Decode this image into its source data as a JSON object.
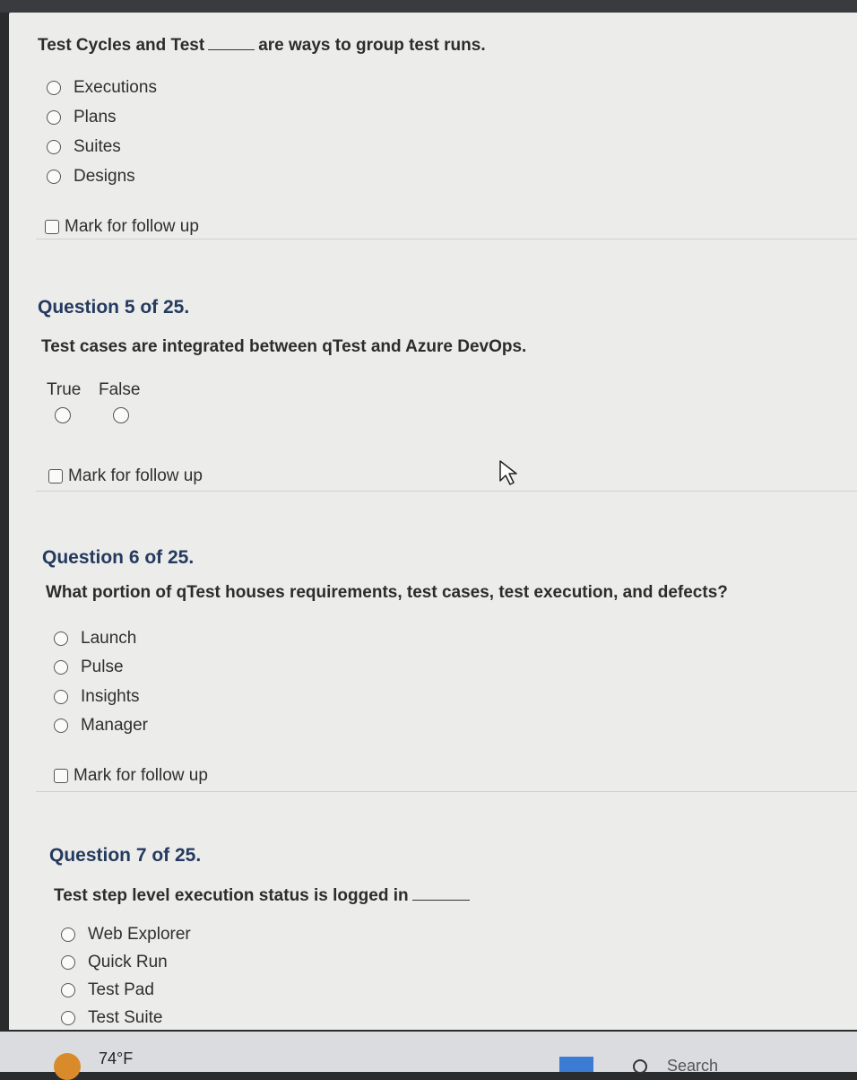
{
  "q4": {
    "text_before": "Test Cycles and Test",
    "text_after": "are ways to group test runs.",
    "options": [
      "Executions",
      "Plans",
      "Suites",
      "Designs"
    ],
    "follow_up": "Mark for follow up"
  },
  "q5": {
    "title": "Question 5 of 25.",
    "text": "Test cases are integrated between qTest and Azure DevOps.",
    "true_label": "True",
    "false_label": "False",
    "follow_up": "Mark for follow up"
  },
  "q6": {
    "title": "Question 6 of 25.",
    "text": "What portion of qTest houses requirements, test cases, test execution, and defects?",
    "options": [
      "Launch",
      "Pulse",
      "Insights",
      "Manager"
    ],
    "follow_up": "Mark for follow up"
  },
  "q7": {
    "title": "Question 7 of 25.",
    "text": "Test step level execution status is logged in",
    "options": [
      "Web Explorer",
      "Quick Run",
      "Test Pad",
      "Test Suite"
    ]
  },
  "taskbar": {
    "temperature": "74°F",
    "search_label": "Search"
  },
  "icons": [
    "weather-icon",
    "search-icon",
    "mouse-cursor-icon",
    "taskbar-app-icon"
  ]
}
